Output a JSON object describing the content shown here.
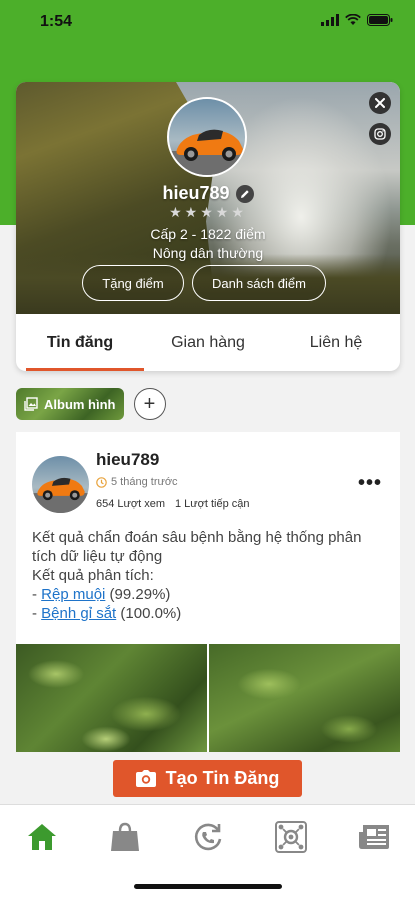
{
  "status_bar": {
    "time": "1:54"
  },
  "profile": {
    "username": "hieu789",
    "stars": "★★★★★",
    "level_text": "Cấp 2 - 1822 điểm",
    "rank": "Nông dân thường",
    "gift_button": "Tặng điểm",
    "points_list_button": "Danh sách điểm"
  },
  "tabs": [
    {
      "label": "Tin đăng",
      "active": true
    },
    {
      "label": "Gian hàng",
      "active": false
    },
    {
      "label": "Liên hệ",
      "active": false
    }
  ],
  "album": {
    "label": "Album hình",
    "add_label": "+"
  },
  "post": {
    "username": "hieu789",
    "time": "5 tháng trước",
    "views": "654 Lượt xem",
    "reach": "1 Lượt tiếp cận",
    "line1": "Kết quả chẩn đoán sâu bệnh bằng hệ thống phân tích dữ liệu tự động",
    "line2": "Kết quả phân tích:",
    "item1_prefix": "- ",
    "item1_link": "Rệp muội",
    "item1_value": " (99.29%)",
    "item2_prefix": "- ",
    "item2_link": "Bệnh gỉ sắt",
    "item2_value": " (100.0%)",
    "more": "•••"
  },
  "create_post_button": "Tạo Tin Đăng",
  "bottom_nav": [
    {
      "icon": "home-icon",
      "active": true
    },
    {
      "icon": "shop-bag-icon",
      "active": false
    },
    {
      "icon": "phone-history-icon",
      "active": false
    },
    {
      "icon": "network-icon",
      "active": false
    },
    {
      "icon": "news-icon",
      "active": false
    }
  ],
  "colors": {
    "green": "#4caf2a",
    "accent": "#e0562b",
    "link": "#1e73c9"
  }
}
